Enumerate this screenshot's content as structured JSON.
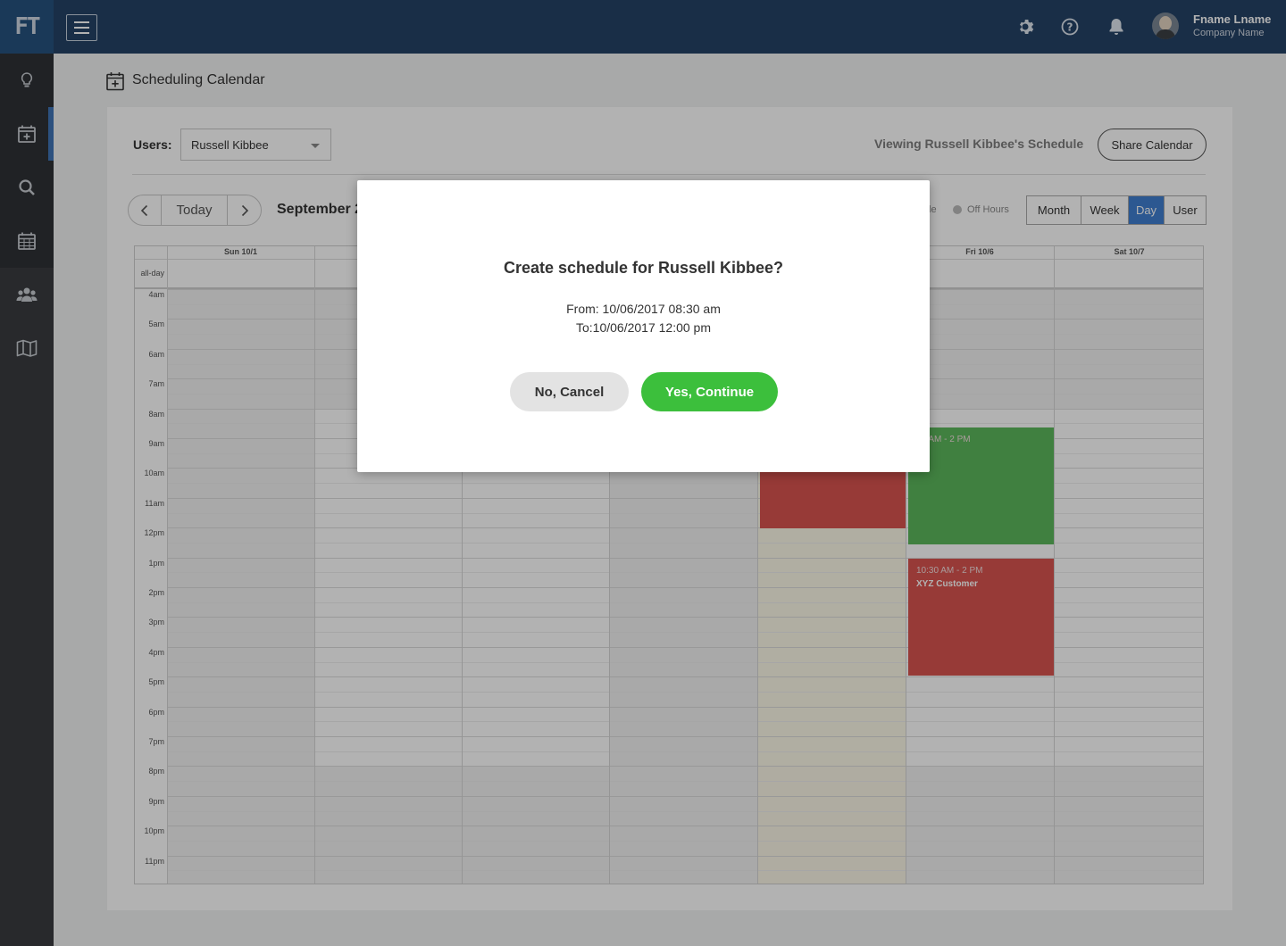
{
  "app": {
    "logo_text": "FT"
  },
  "header": {
    "user_name": "Fname Lname",
    "company_name": "Company Name",
    "icons": [
      "gear-icon",
      "help-icon",
      "bell-icon"
    ]
  },
  "sidebar": {
    "items": [
      {
        "icon": "lightbulb-icon"
      },
      {
        "icon": "calendar-add-icon",
        "active": true
      },
      {
        "icon": "search-icon"
      },
      {
        "icon": "calendar-grid-icon"
      },
      {
        "icon": "users-icon"
      },
      {
        "icon": "map-icon"
      }
    ]
  },
  "page": {
    "title": "Scheduling Calendar"
  },
  "toolbar": {
    "users_label": "Users:",
    "users_value": "Russell Kibbee",
    "viewing_text": "Viewing Russell Kibbee's Schedule",
    "share_label": "Share Calendar",
    "today_label": "Today",
    "month_title": "September 2",
    "legend_fragment": "le",
    "legend_off_hours": "Off Hours",
    "views": [
      "Month",
      "Week",
      "Day",
      "User"
    ],
    "active_view": "Day"
  },
  "calendar": {
    "columns": [
      "Sun 10/1",
      "",
      "",
      "",
      "",
      "Fri 10/6",
      "Sat 10/7"
    ],
    "allday_label": "all-day",
    "hours": [
      "4am",
      "5am",
      "6am",
      "7am",
      "8am",
      "9am",
      "10am",
      "11am",
      "12pm",
      "1pm",
      "2pm",
      "3pm",
      "4pm",
      "5pm",
      "6pm",
      "7pm",
      "8pm",
      "9pm",
      "10pm",
      "11pm"
    ],
    "events": [
      {
        "time": "30 AM - 2 PM",
        "customer": "",
        "color": "#5cb85c"
      },
      {
        "time": "10:30 AM - 2 PM",
        "customer": "XYZ Customer",
        "color": "#d9534f"
      },
      {
        "time": "",
        "customer": "",
        "color": "#d9534f"
      }
    ]
  },
  "modal": {
    "title": "Create schedule for Russell Kibbee?",
    "from": "From: 10/06/2017 08:30 am",
    "to": "To:10/06/2017 12:00 pm",
    "cancel_label": "No, Cancel",
    "continue_label": "Yes, Continue"
  },
  "colors": {
    "topbar": "#244266",
    "sidebar": "#3a3c3f",
    "accent": "#3f7fd0",
    "continue": "#3cbf3c",
    "event_red": "#d9534f",
    "event_green": "#5cb85c"
  }
}
